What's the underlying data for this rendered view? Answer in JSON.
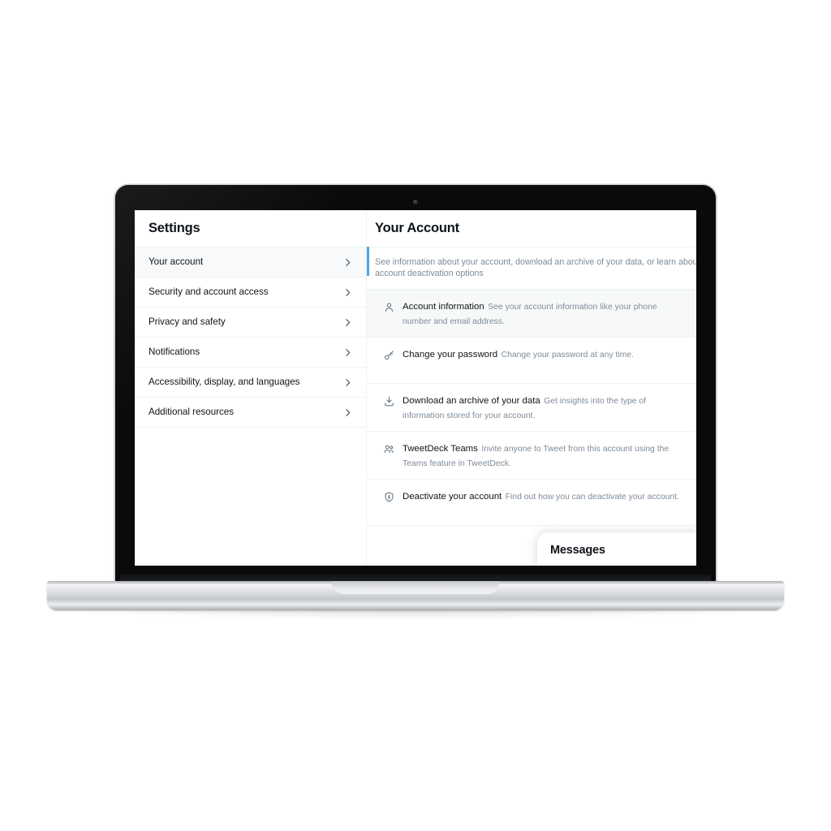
{
  "device": {
    "type": "laptop-mockup",
    "webcam": "webcam-dot"
  },
  "sidebar": {
    "title": "Settings",
    "items": [
      {
        "label": "Your account",
        "chevron": "chevron-right-icon",
        "active": true
      },
      {
        "label": "Security and account access",
        "chevron": "chevron-right-icon",
        "active": false
      },
      {
        "label": "Privacy and safety",
        "chevron": "chevron-right-icon",
        "active": false
      },
      {
        "label": "Notifications",
        "chevron": "chevron-right-icon",
        "active": false
      },
      {
        "label": "Accessibility, display, and languages",
        "chevron": "chevron-right-icon",
        "active": false
      },
      {
        "label": "Additional resources",
        "chevron": "chevron-right-icon",
        "active": false
      }
    ]
  },
  "content": {
    "title": "Your Account",
    "description": "See information about your account, download an archive of your data, or learn about your account deactivation options",
    "options": [
      {
        "icon": "person-icon",
        "title": "Account information",
        "subtitle": "See your account information like your phone number and email address.",
        "hovered": true
      },
      {
        "icon": "key-icon",
        "title": "Change your password",
        "subtitle": "Change your password at any time.",
        "hovered": false
      },
      {
        "icon": "download-icon",
        "title": "Download an archive of your data",
        "subtitle": "Get insights into the type of information stored for your account.",
        "hovered": false
      },
      {
        "icon": "people-group-icon",
        "title": "TweetDeck Teams",
        "subtitle": "Invite anyone to Tweet from this account using the Teams feature in TweetDeck.",
        "hovered": false
      },
      {
        "icon": "shield-broken-icon",
        "title": "Deactivate your account",
        "subtitle": "Find out how you can deactivate your account.",
        "hovered": false
      }
    ]
  },
  "messages_dock": {
    "title": "Messages"
  },
  "colors": {
    "accent_blue": "#4aa8e8",
    "text_primary": "#0f1419",
    "text_secondary": "#7d8b98",
    "divider": "#eff3f4",
    "row_hover": "#f7f9f9",
    "bezel": "#0a0a0a",
    "page_background": "#ffffff"
  }
}
